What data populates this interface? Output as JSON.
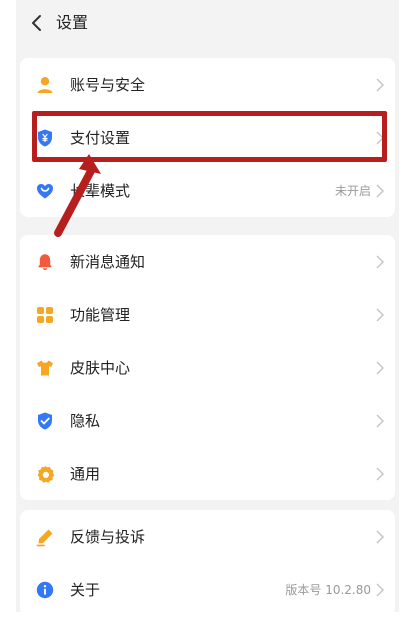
{
  "header": {
    "title": "设置"
  },
  "groups": [
    {
      "items": [
        {
          "label": "账号与安全",
          "value": ""
        },
        {
          "label": "支付设置",
          "value": ""
        },
        {
          "label": "长辈模式",
          "value": "未开启"
        }
      ]
    },
    {
      "items": [
        {
          "label": "新消息通知",
          "value": ""
        },
        {
          "label": "功能管理",
          "value": ""
        },
        {
          "label": "皮肤中心",
          "value": ""
        },
        {
          "label": "隐私",
          "value": ""
        },
        {
          "label": "通用",
          "value": ""
        }
      ]
    },
    {
      "items": [
        {
          "label": "反馈与投诉",
          "value": ""
        },
        {
          "label": "关于",
          "value": "版本号 10.2.80"
        }
      ]
    }
  ],
  "icons": [
    "user-icon",
    "shield-pay-icon",
    "heart-icon",
    "bell-icon",
    "grid-icon",
    "tshirt-icon",
    "privacy-shield-icon",
    "gear-icon",
    "pencil-icon",
    "info-icon"
  ],
  "colors": {
    "blue": "#3478f6",
    "orange": "#f5a623",
    "red": "#f35a3d",
    "highlight": "#b71f1f"
  }
}
